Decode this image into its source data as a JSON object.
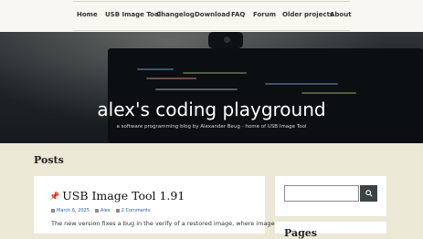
{
  "nav": {
    "items": [
      {
        "label": "Home"
      },
      {
        "label": "USB Image Tool"
      },
      {
        "label": "Changelog"
      },
      {
        "label": "Download"
      },
      {
        "label": "FAQ"
      },
      {
        "label": "Forum"
      },
      {
        "label": "Older projects"
      },
      {
        "label": "About"
      }
    ]
  },
  "hero": {
    "title": "alex's coding playground",
    "subtitle": "a software programming blog by Alexander Beug - home of USB Image Tool"
  },
  "main": {
    "heading": "Posts",
    "post": {
      "title": "USB Image Tool 1.91",
      "date": "March 6, 2025",
      "author": "Alex",
      "comments": "2 Comments",
      "excerpt": "The new version fixes a bug in the verify of a restored image, where images"
    }
  },
  "sidebar": {
    "search": {
      "placeholder": "",
      "value": ""
    },
    "pages_heading": "Pages"
  },
  "colors": {
    "background": "#ece8d6",
    "nav_background": "#f8f7f1",
    "hero_dark": "#1e2427",
    "search_button": "#3b4346",
    "link": "#2b5ea7"
  },
  "icons": {
    "pin": "pushpin-icon",
    "date": "calendar-icon",
    "author": "user-icon",
    "comments": "comment-icon",
    "search": "search-icon"
  }
}
